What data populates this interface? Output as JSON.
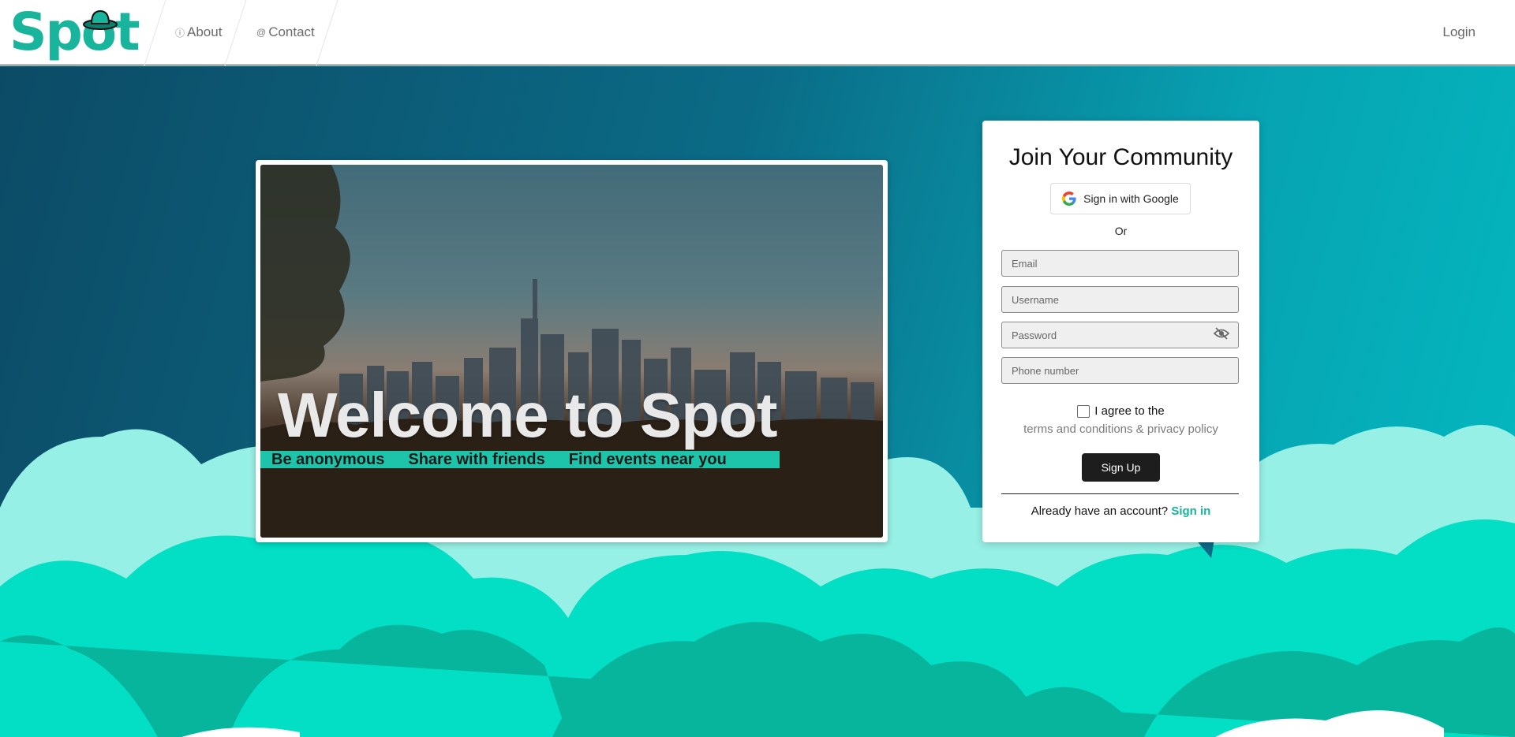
{
  "nav": {
    "logo_text": "Spot",
    "about_label": "About",
    "contact_label": "Contact",
    "login_label": "Login",
    "about_icon": "info-icon",
    "contact_icon": "at-icon"
  },
  "hero": {
    "title": "Welcome to Spot",
    "taglines": [
      "Be anonymous",
      "Share with friends",
      "Find events near you"
    ]
  },
  "signup": {
    "title": "Join Your Community",
    "google_label": "Sign in with Google",
    "or_label": "Or",
    "email_placeholder": "Email",
    "username_placeholder": "Username",
    "password_placeholder": "Password",
    "phone_placeholder": "Phone number",
    "agree_label": "I agree to the",
    "terms_label": "terms and conditions & privacy policy",
    "button_label": "Sign Up",
    "already_label": "Already have an account?",
    "signin_label": "Sign in"
  },
  "colors": {
    "brand": "#18b49c",
    "hero_dark": "#0c4b66",
    "hero_light": "#03bac0",
    "cloud_light": "#97f0e5",
    "cloud_mid": "#02dfc5",
    "cloud_dark": "#06b59c"
  }
}
